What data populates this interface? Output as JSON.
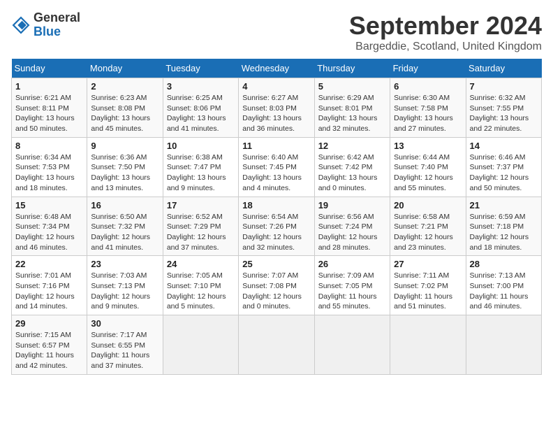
{
  "header": {
    "logo_line1": "General",
    "logo_line2": "Blue",
    "title": "September 2024",
    "subtitle": "Bargeddie, Scotland, United Kingdom"
  },
  "days_of_week": [
    "Sunday",
    "Monday",
    "Tuesday",
    "Wednesday",
    "Thursday",
    "Friday",
    "Saturday"
  ],
  "weeks": [
    [
      {
        "num": "1",
        "sunrise": "6:21 AM",
        "sunset": "8:11 PM",
        "daylight": "13 hours and 50 minutes."
      },
      {
        "num": "2",
        "sunrise": "6:23 AM",
        "sunset": "8:08 PM",
        "daylight": "13 hours and 45 minutes."
      },
      {
        "num": "3",
        "sunrise": "6:25 AM",
        "sunset": "8:06 PM",
        "daylight": "13 hours and 41 minutes."
      },
      {
        "num": "4",
        "sunrise": "6:27 AM",
        "sunset": "8:03 PM",
        "daylight": "13 hours and 36 minutes."
      },
      {
        "num": "5",
        "sunrise": "6:29 AM",
        "sunset": "8:01 PM",
        "daylight": "13 hours and 32 minutes."
      },
      {
        "num": "6",
        "sunrise": "6:30 AM",
        "sunset": "7:58 PM",
        "daylight": "13 hours and 27 minutes."
      },
      {
        "num": "7",
        "sunrise": "6:32 AM",
        "sunset": "7:55 PM",
        "daylight": "13 hours and 22 minutes."
      }
    ],
    [
      {
        "num": "8",
        "sunrise": "6:34 AM",
        "sunset": "7:53 PM",
        "daylight": "13 hours and 18 minutes."
      },
      {
        "num": "9",
        "sunrise": "6:36 AM",
        "sunset": "7:50 PM",
        "daylight": "13 hours and 13 minutes."
      },
      {
        "num": "10",
        "sunrise": "6:38 AM",
        "sunset": "7:47 PM",
        "daylight": "13 hours and 9 minutes."
      },
      {
        "num": "11",
        "sunrise": "6:40 AM",
        "sunset": "7:45 PM",
        "daylight": "13 hours and 4 minutes."
      },
      {
        "num": "12",
        "sunrise": "6:42 AM",
        "sunset": "7:42 PM",
        "daylight": "13 hours and 0 minutes."
      },
      {
        "num": "13",
        "sunrise": "6:44 AM",
        "sunset": "7:40 PM",
        "daylight": "12 hours and 55 minutes."
      },
      {
        "num": "14",
        "sunrise": "6:46 AM",
        "sunset": "7:37 PM",
        "daylight": "12 hours and 50 minutes."
      }
    ],
    [
      {
        "num": "15",
        "sunrise": "6:48 AM",
        "sunset": "7:34 PM",
        "daylight": "12 hours and 46 minutes."
      },
      {
        "num": "16",
        "sunrise": "6:50 AM",
        "sunset": "7:32 PM",
        "daylight": "12 hours and 41 minutes."
      },
      {
        "num": "17",
        "sunrise": "6:52 AM",
        "sunset": "7:29 PM",
        "daylight": "12 hours and 37 minutes."
      },
      {
        "num": "18",
        "sunrise": "6:54 AM",
        "sunset": "7:26 PM",
        "daylight": "12 hours and 32 minutes."
      },
      {
        "num": "19",
        "sunrise": "6:56 AM",
        "sunset": "7:24 PM",
        "daylight": "12 hours and 28 minutes."
      },
      {
        "num": "20",
        "sunrise": "6:58 AM",
        "sunset": "7:21 PM",
        "daylight": "12 hours and 23 minutes."
      },
      {
        "num": "21",
        "sunrise": "6:59 AM",
        "sunset": "7:18 PM",
        "daylight": "12 hours and 18 minutes."
      }
    ],
    [
      {
        "num": "22",
        "sunrise": "7:01 AM",
        "sunset": "7:16 PM",
        "daylight": "12 hours and 14 minutes."
      },
      {
        "num": "23",
        "sunrise": "7:03 AM",
        "sunset": "7:13 PM",
        "daylight": "12 hours and 9 minutes."
      },
      {
        "num": "24",
        "sunrise": "7:05 AM",
        "sunset": "7:10 PM",
        "daylight": "12 hours and 5 minutes."
      },
      {
        "num": "25",
        "sunrise": "7:07 AM",
        "sunset": "7:08 PM",
        "daylight": "12 hours and 0 minutes."
      },
      {
        "num": "26",
        "sunrise": "7:09 AM",
        "sunset": "7:05 PM",
        "daylight": "11 hours and 55 minutes."
      },
      {
        "num": "27",
        "sunrise": "7:11 AM",
        "sunset": "7:02 PM",
        "daylight": "11 hours and 51 minutes."
      },
      {
        "num": "28",
        "sunrise": "7:13 AM",
        "sunset": "7:00 PM",
        "daylight": "11 hours and 46 minutes."
      }
    ],
    [
      {
        "num": "29",
        "sunrise": "7:15 AM",
        "sunset": "6:57 PM",
        "daylight": "11 hours and 42 minutes."
      },
      {
        "num": "30",
        "sunrise": "7:17 AM",
        "sunset": "6:55 PM",
        "daylight": "11 hours and 37 minutes."
      },
      null,
      null,
      null,
      null,
      null
    ]
  ]
}
